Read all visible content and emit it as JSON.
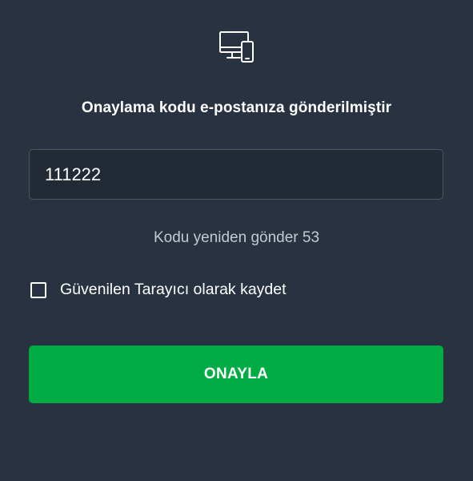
{
  "header": {
    "icon": "desktop-and-mobile-icon",
    "title": "Onaylama kodu e-postanıza gönderilmiştir"
  },
  "code_input": {
    "value": "111222",
    "placeholder": ""
  },
  "resend": {
    "label": "Kodu yeniden gönder",
    "countdown": "53"
  },
  "remember_browser": {
    "label": "Güvenilen Tarayıcı olarak kaydet",
    "checked": false
  },
  "confirm_button": {
    "label": "ONAYLA"
  },
  "colors": {
    "background": "#283241",
    "input_background": "#222a36",
    "input_border": "#4b5668",
    "accent_green": "#00ac43",
    "muted_text": "#c4c9d1"
  }
}
